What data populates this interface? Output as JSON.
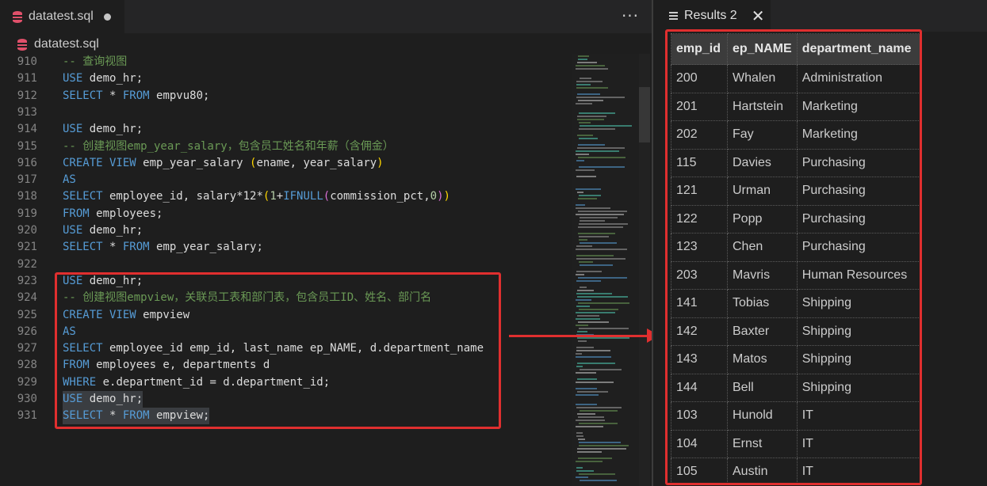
{
  "editor": {
    "tab_label": "datatest.sql",
    "breadcrumb_label": "datatest.sql",
    "more_actions": "···",
    "lines": [
      {
        "n": "910",
        "tokens": [
          [
            "cm",
            "-- 查询视图"
          ]
        ]
      },
      {
        "n": "911",
        "tokens": [
          [
            "kw",
            "USE"
          ],
          [
            "id",
            " demo_hr;"
          ]
        ]
      },
      {
        "n": "912",
        "tokens": [
          [
            "kw",
            "SELECT"
          ],
          [
            "id",
            " * "
          ],
          [
            "kw",
            "FROM"
          ],
          [
            "id",
            " empvu80;"
          ]
        ]
      },
      {
        "n": "913",
        "tokens": []
      },
      {
        "n": "914",
        "tokens": [
          [
            "kw",
            "USE"
          ],
          [
            "id",
            " demo_hr;"
          ]
        ]
      },
      {
        "n": "915",
        "tokens": [
          [
            "cm",
            "-- 创建视图emp_year_salary，包含员工姓名和年薪（含佣金）"
          ]
        ]
      },
      {
        "n": "916",
        "tokens": [
          [
            "kw",
            "CREATE VIEW"
          ],
          [
            "id",
            " emp_year_salary "
          ],
          [
            "par",
            "("
          ],
          [
            "id",
            "ename, year_salary"
          ],
          [
            "par",
            ")"
          ]
        ]
      },
      {
        "n": "917",
        "tokens": [
          [
            "kw",
            "AS"
          ]
        ]
      },
      {
        "n": "918",
        "tokens": [
          [
            "kw",
            "SELECT"
          ],
          [
            "id",
            " employee_id, salary*12*"
          ],
          [
            "par",
            "("
          ],
          [
            "num",
            "1"
          ],
          [
            "id",
            "+"
          ],
          [
            "kw",
            "IFNULL"
          ],
          [
            "par2",
            "("
          ],
          [
            "id",
            "commission_pct,"
          ],
          [
            "num",
            "0"
          ],
          [
            "par2",
            ")"
          ],
          [
            "par",
            ")"
          ]
        ]
      },
      {
        "n": "919",
        "tokens": [
          [
            "kw",
            "FROM"
          ],
          [
            "id",
            " employees;"
          ]
        ]
      },
      {
        "n": "920",
        "tokens": [
          [
            "kw",
            "USE"
          ],
          [
            "id",
            " demo_hr;"
          ]
        ]
      },
      {
        "n": "921",
        "tokens": [
          [
            "kw",
            "SELECT"
          ],
          [
            "id",
            " * "
          ],
          [
            "kw",
            "FROM"
          ],
          [
            "id",
            " emp_year_salary;"
          ]
        ]
      },
      {
        "n": "922",
        "tokens": []
      },
      {
        "n": "923",
        "tokens": [
          [
            "kw",
            "USE"
          ],
          [
            "id",
            " demo_hr;"
          ]
        ]
      },
      {
        "n": "924",
        "tokens": [
          [
            "cm",
            "-- 创建视图empview，关联员工表和部门表，包含员工ID、姓名、部门名"
          ]
        ]
      },
      {
        "n": "925",
        "tokens": [
          [
            "kw",
            "CREATE VIEW"
          ],
          [
            "id",
            " empview"
          ]
        ]
      },
      {
        "n": "926",
        "tokens": [
          [
            "kw",
            "AS"
          ]
        ]
      },
      {
        "n": "927",
        "tokens": [
          [
            "kw",
            "SELECT"
          ],
          [
            "id",
            " employee_id emp_id, last_name ep_NAME, d.department_name"
          ]
        ]
      },
      {
        "n": "928",
        "tokens": [
          [
            "kw",
            "FROM"
          ],
          [
            "id",
            " employees e, departments d"
          ]
        ]
      },
      {
        "n": "929",
        "tokens": [
          [
            "kw",
            "WHERE"
          ],
          [
            "id",
            " e.department_id = d.department_id;"
          ]
        ]
      },
      {
        "n": "930",
        "sel": true,
        "tokens": [
          [
            "kw",
            "USE"
          ],
          [
            "id",
            " demo_hr;"
          ]
        ]
      },
      {
        "n": "931",
        "sel": true,
        "tokens": [
          [
            "kw",
            "SELECT"
          ],
          [
            "id",
            " * "
          ],
          [
            "kw",
            "FROM"
          ],
          [
            "id",
            " empview;"
          ]
        ]
      }
    ]
  },
  "results": {
    "tab_label": "Results 2",
    "close_glyph": "✕",
    "columns": [
      "emp_id",
      "ep_NAME",
      "department_name"
    ],
    "rows": [
      [
        "200",
        "Whalen",
        "Administration"
      ],
      [
        "201",
        "Hartstein",
        "Marketing"
      ],
      [
        "202",
        "Fay",
        "Marketing"
      ],
      [
        "115",
        "Davies",
        "Purchasing"
      ],
      [
        "121",
        "Urman",
        "Purchasing"
      ],
      [
        "122",
        "Popp",
        "Purchasing"
      ],
      [
        "123",
        "Chen",
        "Purchasing"
      ],
      [
        "203",
        "Mavris",
        "Human Resources"
      ],
      [
        "141",
        "Tobias",
        "Shipping"
      ],
      [
        "142",
        "Baxter",
        "Shipping"
      ],
      [
        "143",
        "Matos",
        "Shipping"
      ],
      [
        "144",
        "Bell",
        "Shipping"
      ],
      [
        "103",
        "Hunold",
        "IT"
      ],
      [
        "104",
        "Ernst",
        "IT"
      ],
      [
        "105",
        "Austin",
        "IT"
      ]
    ]
  },
  "icons": {
    "file_icon": "database-icon",
    "results_icon": "list-icon",
    "close_icon": "close-icon"
  },
  "colors": {
    "highlight": "#e02f2f",
    "keyword": "#569cd6",
    "comment": "#6a9955"
  }
}
